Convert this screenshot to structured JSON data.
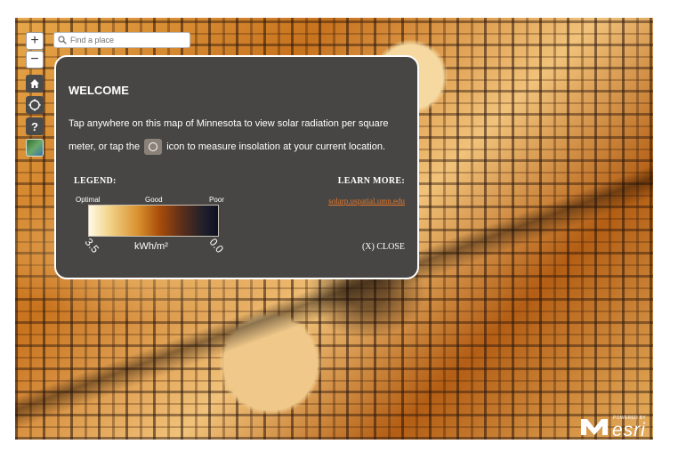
{
  "search": {
    "placeholder": "Find a place"
  },
  "controls": {
    "zoom_in": "+",
    "zoom_out": "−",
    "help": "?"
  },
  "welcome": {
    "title": "WELCOME",
    "intro_part1": "Tap anywhere on this map of Minnesota to view solar radiation per square meter, or tap the",
    "intro_part2": "icon to measure insolation at your current location.",
    "legend_title": "LEGEND:",
    "legend_labels": [
      "Optimal",
      "Good",
      "Poor"
    ],
    "legend_max": "3.5",
    "legend_min": "0.0",
    "legend_units": "kWh/m²",
    "learn_more_title": "LEARN MORE:",
    "learn_more_link": "solarp.uspatial.umn.edu",
    "close_label": "(X) CLOSE"
  },
  "branding": {
    "powered_by": "POWERED BY",
    "esri": "esri"
  },
  "colors": {
    "panel_bg": "#484644",
    "link": "#e97a2b",
    "control_bg": "#4a4a4a"
  }
}
